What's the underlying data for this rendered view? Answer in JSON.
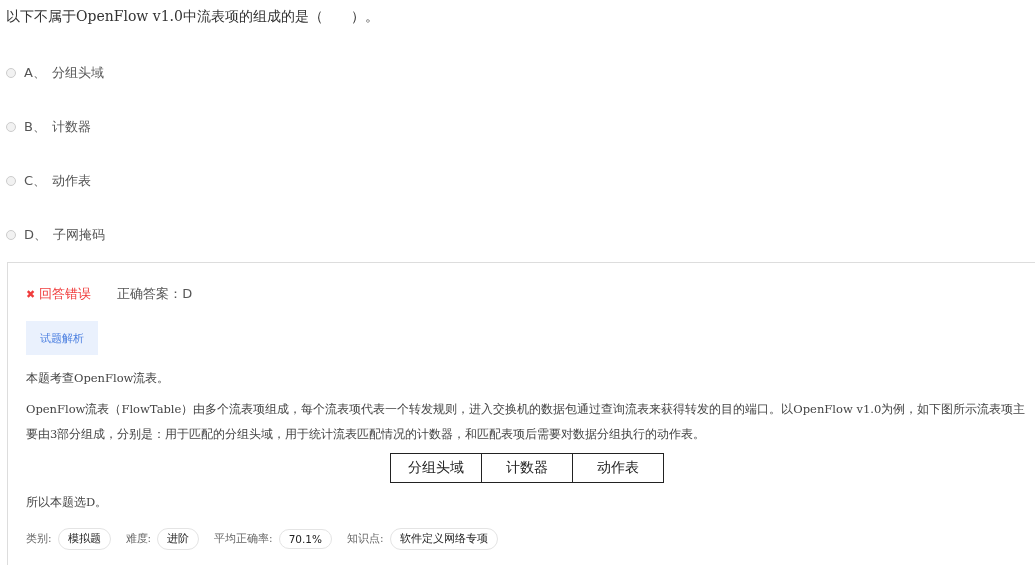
{
  "question": "以下不属于OpenFlow v1.0中流表项的组成的是（　　）。",
  "options": [
    {
      "letter": "A、",
      "text": "分组头域",
      "selected": false
    },
    {
      "letter": "B、",
      "text": "计数器",
      "selected": false
    },
    {
      "letter": "C、",
      "text": "动作表",
      "selected": false
    },
    {
      "letter": "D、",
      "text": "子网掩码",
      "selected": false
    }
  ],
  "result": {
    "icon": "✖",
    "status": "回答错误",
    "correct_answer": "正确答案：D"
  },
  "analysis_button": "试题解析",
  "analysis": {
    "intro": "本题考查OpenFlow流表。",
    "paragraph": "OpenFlow流表（FlowTable）由多个流表项组成，每个流表项代表一个转发规则，进入交换机的数据包通过查询流表来获得转发的目的端口。以OpenFlow v1.0为例，如下图所示流表项主要由3部分组成，分别是：用于匹配的分组头域，用于统计流表匹配情况的计数器，和匹配表项后需要对数据分组执行的动作表。",
    "table": [
      "分组头域",
      "计数器",
      "动作表"
    ],
    "conclusion": "所以本题选D。"
  },
  "meta": [
    {
      "label": "类别:",
      "value": "模拟题"
    },
    {
      "label": "难度:",
      "value": "进阶"
    },
    {
      "label": "平均正确率:",
      "value": "70.1%"
    },
    {
      "label": "知识点:",
      "value": "软件定义网络专项"
    }
  ]
}
